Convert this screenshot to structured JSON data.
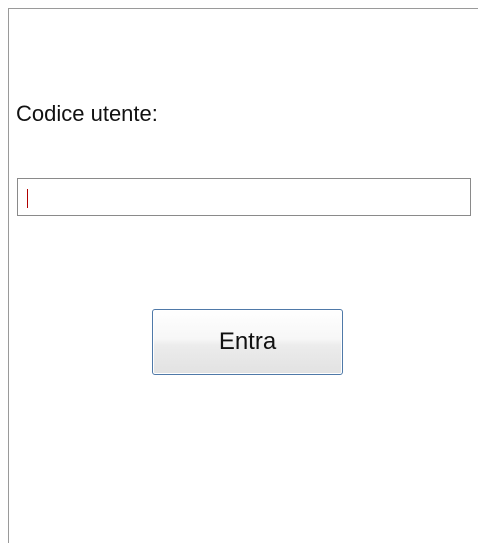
{
  "form": {
    "user_code_label": "Codice utente:",
    "user_code_value": "",
    "submit_label": "Entra"
  }
}
